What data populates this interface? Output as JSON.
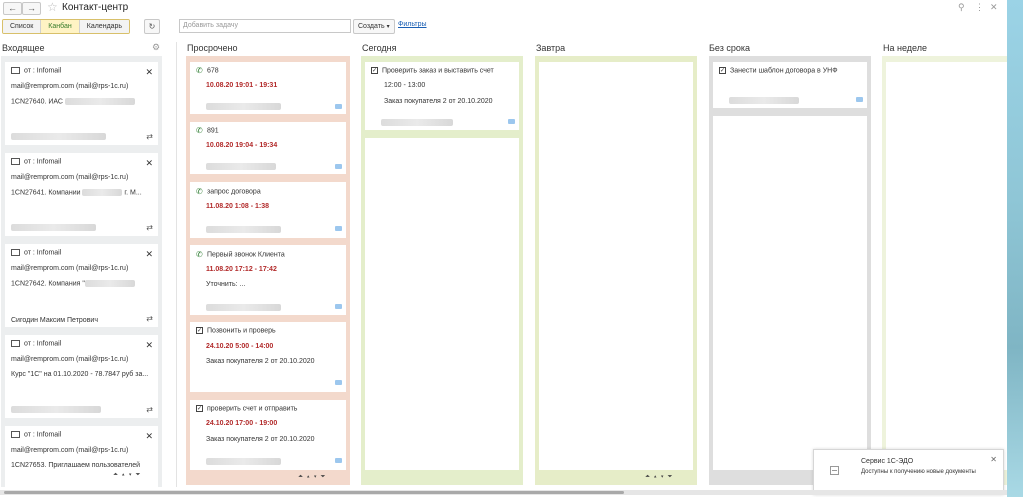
{
  "window": {
    "title": "Контакт-центр"
  },
  "toolbar": {
    "view_tabs": [
      "Список",
      "Канбан",
      "Календарь"
    ],
    "search_placeholder": "Добавить задачу",
    "create_label": "Создать",
    "filters_label": "Фильтры"
  },
  "columns": {
    "inbox": "Входящее",
    "overdue": "Просрочено",
    "today": "Сегодня",
    "tomorrow": "Завтра",
    "no_deadline": "Без срока",
    "this_week": "На неделе"
  },
  "inbox": [
    {
      "from": "от : Infomail",
      "email": "mail@remprom.com (mail@rps-1c.ru)",
      "subject": "1CN27640. ИАС",
      "footer": ""
    },
    {
      "from": "от : Infomail",
      "email": "mail@remprom.com (mail@rps-1c.ru)",
      "subject": "1CN27641. Компании",
      "subject_tail": "г. М...",
      "footer": ""
    },
    {
      "from": "от : Infomail",
      "email": "mail@remprom.com (mail@rps-1c.ru)",
      "subject": "1CN27642.  Компания \"",
      "footer": "Сигодин Максим Петрович"
    },
    {
      "from": "от : Infomail",
      "email": "mail@remprom.com (mail@rps-1c.ru)",
      "subject": "Курс \"1С\" на 01.10.2020 - 78.7847 руб за...",
      "footer": ""
    },
    {
      "from": "от : Infomail",
      "email": "mail@remprom.com (mail@rps-1c.ru)",
      "subject": "1CN27653. Приглашаем пользователей",
      "footer": ""
    }
  ],
  "overdue": [
    {
      "icon": "phone",
      "title": "678",
      "date": "10.08.20 19:01 - 19:31",
      "note": ""
    },
    {
      "icon": "phone",
      "title": "891",
      "date": "10.08.20 19:04 - 19:34",
      "note": ""
    },
    {
      "icon": "phone",
      "title": "запрос договора",
      "date": "11.08.20 1:08 - 1:38",
      "note": ""
    },
    {
      "icon": "phone",
      "title": "Первый звонок Клиента",
      "date": "11.08.20 17:12 - 17:42",
      "note": "Уточнить: ..."
    },
    {
      "icon": "task",
      "title": "Позвонить и проверь",
      "date": "24.10.20 5:00 - 14:00",
      "note": "Заказ покупателя 2 от 20.10.2020"
    },
    {
      "icon": "task",
      "title": "проверить счет и отправить",
      "date": "24.10.20 17:00 - 19:00",
      "note": "Заказ покупателя 2 от 20.10.2020"
    }
  ],
  "today": [
    {
      "icon": "task",
      "title": "Проверить заказ и выставить счет",
      "time": "12:00 - 13:00",
      "note": "Заказ покупателя 2 от 20.10.2020"
    }
  ],
  "no_deadline": [
    {
      "icon": "task",
      "title": "Занести шаблон договора в УНФ"
    }
  ],
  "notification": {
    "title": "Сервис 1С-ЭДО",
    "text": "Доступны к получению новые документы"
  },
  "colors": {
    "overdue_bg": "#f3d9cc",
    "today_bg": "#e4eecb",
    "tomorrow_bg": "#e6edc8",
    "no_deadline_bg": "#dedede",
    "week_bg": "#eef3dc",
    "date_red": "#b22a2a",
    "active_tab": "#fff3c4"
  }
}
